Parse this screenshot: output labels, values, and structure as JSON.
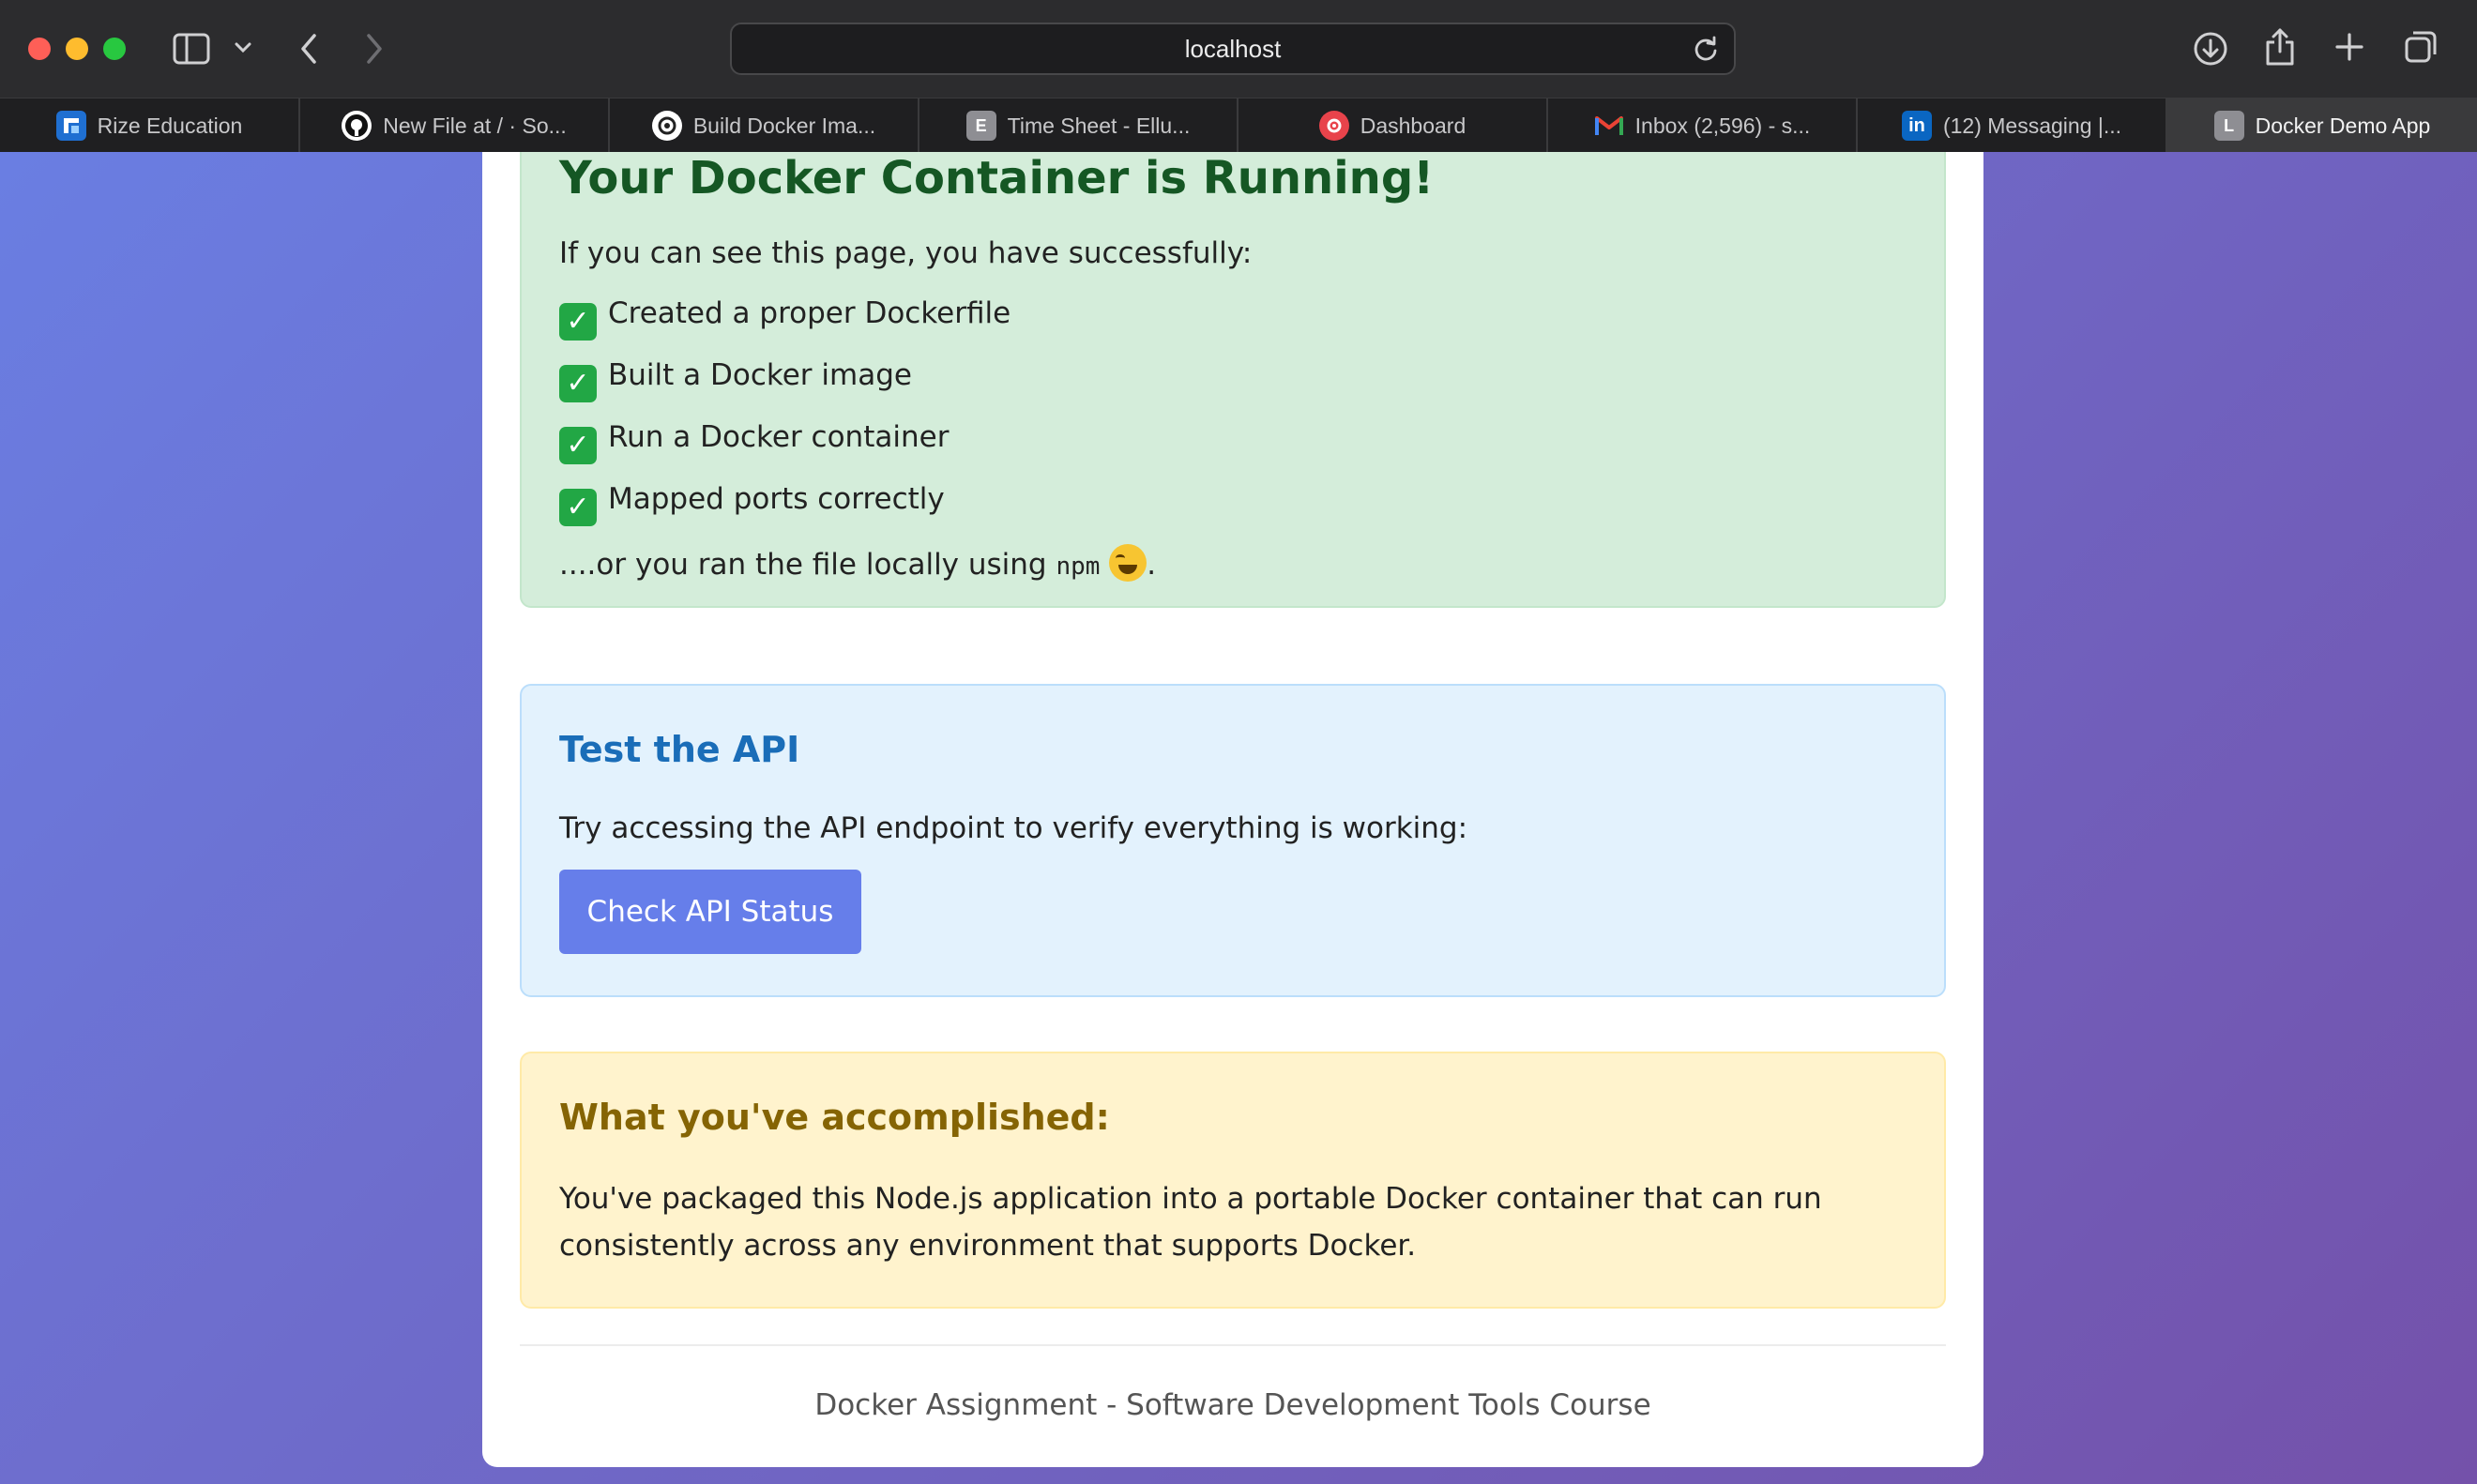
{
  "browser": {
    "address": "localhost",
    "tabs": [
      {
        "label": "Rize Education",
        "icon": "rize-icon",
        "favicon_color": "#1f6fd1"
      },
      {
        "label": "New File at / · So...",
        "icon": "github-icon",
        "favicon_color": "#ffffff"
      },
      {
        "label": "Build Docker Ima...",
        "icon": "openai-icon",
        "favicon_color": "#ffffff"
      },
      {
        "label": "Time Sheet - Ellu...",
        "icon": "letter-e-icon",
        "favicon_color": "#8e8e93",
        "favicon_letter": "E"
      },
      {
        "label": "Dashboard",
        "icon": "dashboard-icon",
        "favicon_color": "#e8434b"
      },
      {
        "label": "Inbox (2,596) - s...",
        "icon": "gmail-icon",
        "favicon_color": "#ea4335"
      },
      {
        "label": "(12) Messaging |...",
        "icon": "linkedin-icon",
        "favicon_color": "#0a66c2",
        "favicon_letter": "in"
      },
      {
        "label": "Docker Demo App",
        "icon": "letter-l-icon",
        "favicon_color": "#8e8e93",
        "favicon_letter": "L"
      }
    ]
  },
  "success": {
    "heading": "Your Docker Container is Running!",
    "intro": "If you can see this page, you have successfully:",
    "items": [
      "Created a proper Dockerfile",
      "Built a Docker image",
      "Run a Docker container",
      "Mapped ports correctly"
    ],
    "tail_prefix": "....or you ran the file locally using ",
    "tail_code": "npm",
    "tail_suffix": "."
  },
  "api": {
    "heading": "Test the API",
    "text": "Try accessing the API endpoint to verify everything is working:",
    "button": "Check API Status"
  },
  "accomplished": {
    "heading": "What you've accomplished:",
    "text": "You've packaged this Node.js application into a portable Docker container that can run consistently across any environment that supports Docker."
  },
  "footer": "Docker Assignment - Software Development Tools Course",
  "colors": {
    "gradient_start": "#6a7ee2",
    "gradient_end": "#7451aa",
    "button": "#667eea",
    "success_heading": "#155724",
    "info_heading": "#1a6db8",
    "warn_heading": "#856404"
  }
}
